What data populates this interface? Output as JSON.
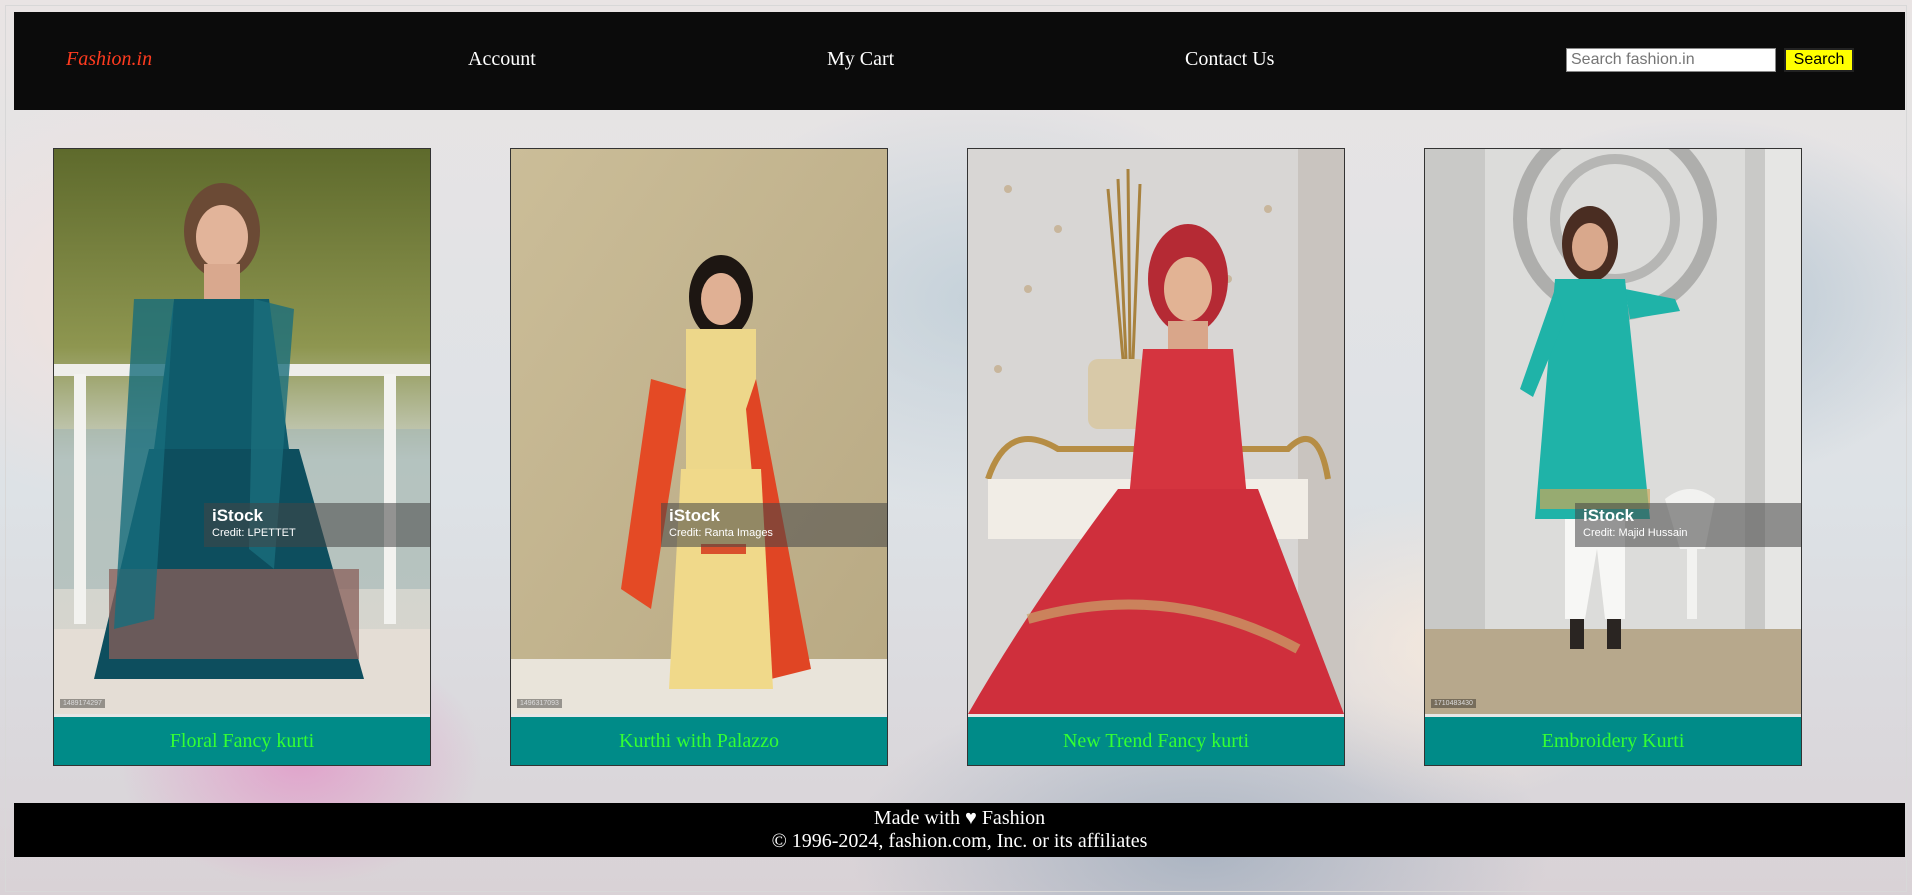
{
  "header": {
    "logo": "Fashion.in",
    "nav": {
      "account": "Account",
      "cart": "My Cart",
      "contact": "Contact Us"
    },
    "search": {
      "placeholder": "Search fashion.in",
      "value": "",
      "button_label": "Search"
    }
  },
  "products": [
    {
      "title": "Floral Fancy kurti",
      "watermark_brand": "iStock",
      "watermark_credit": "Credit: LPETTET",
      "stock_id": "1489174297"
    },
    {
      "title": "Kurthi with Palazzo",
      "watermark_brand": "iStock",
      "watermark_credit": "Credit: Ranta Images",
      "stock_id": "1496317093"
    },
    {
      "title": "New Trend Fancy kurti",
      "watermark_brand": "",
      "watermark_credit": "",
      "stock_id": ""
    },
    {
      "title": "Embroidery Kurti",
      "watermark_brand": "iStock",
      "watermark_credit": "Credit: Majid Hussain",
      "stock_id": "1710483430"
    }
  ],
  "footer": {
    "line1": "Made with ♥ Fashion",
    "line2": "© 1996-2024, fashion.com, Inc. or its affiliates"
  },
  "colors": {
    "nav_background": "#0b0b0b",
    "logo": "#ff3b1f",
    "search_button": "#ffff00",
    "caption_background": "#008b88",
    "caption_text": "#33ff33",
    "footer_background": "#000000"
  }
}
